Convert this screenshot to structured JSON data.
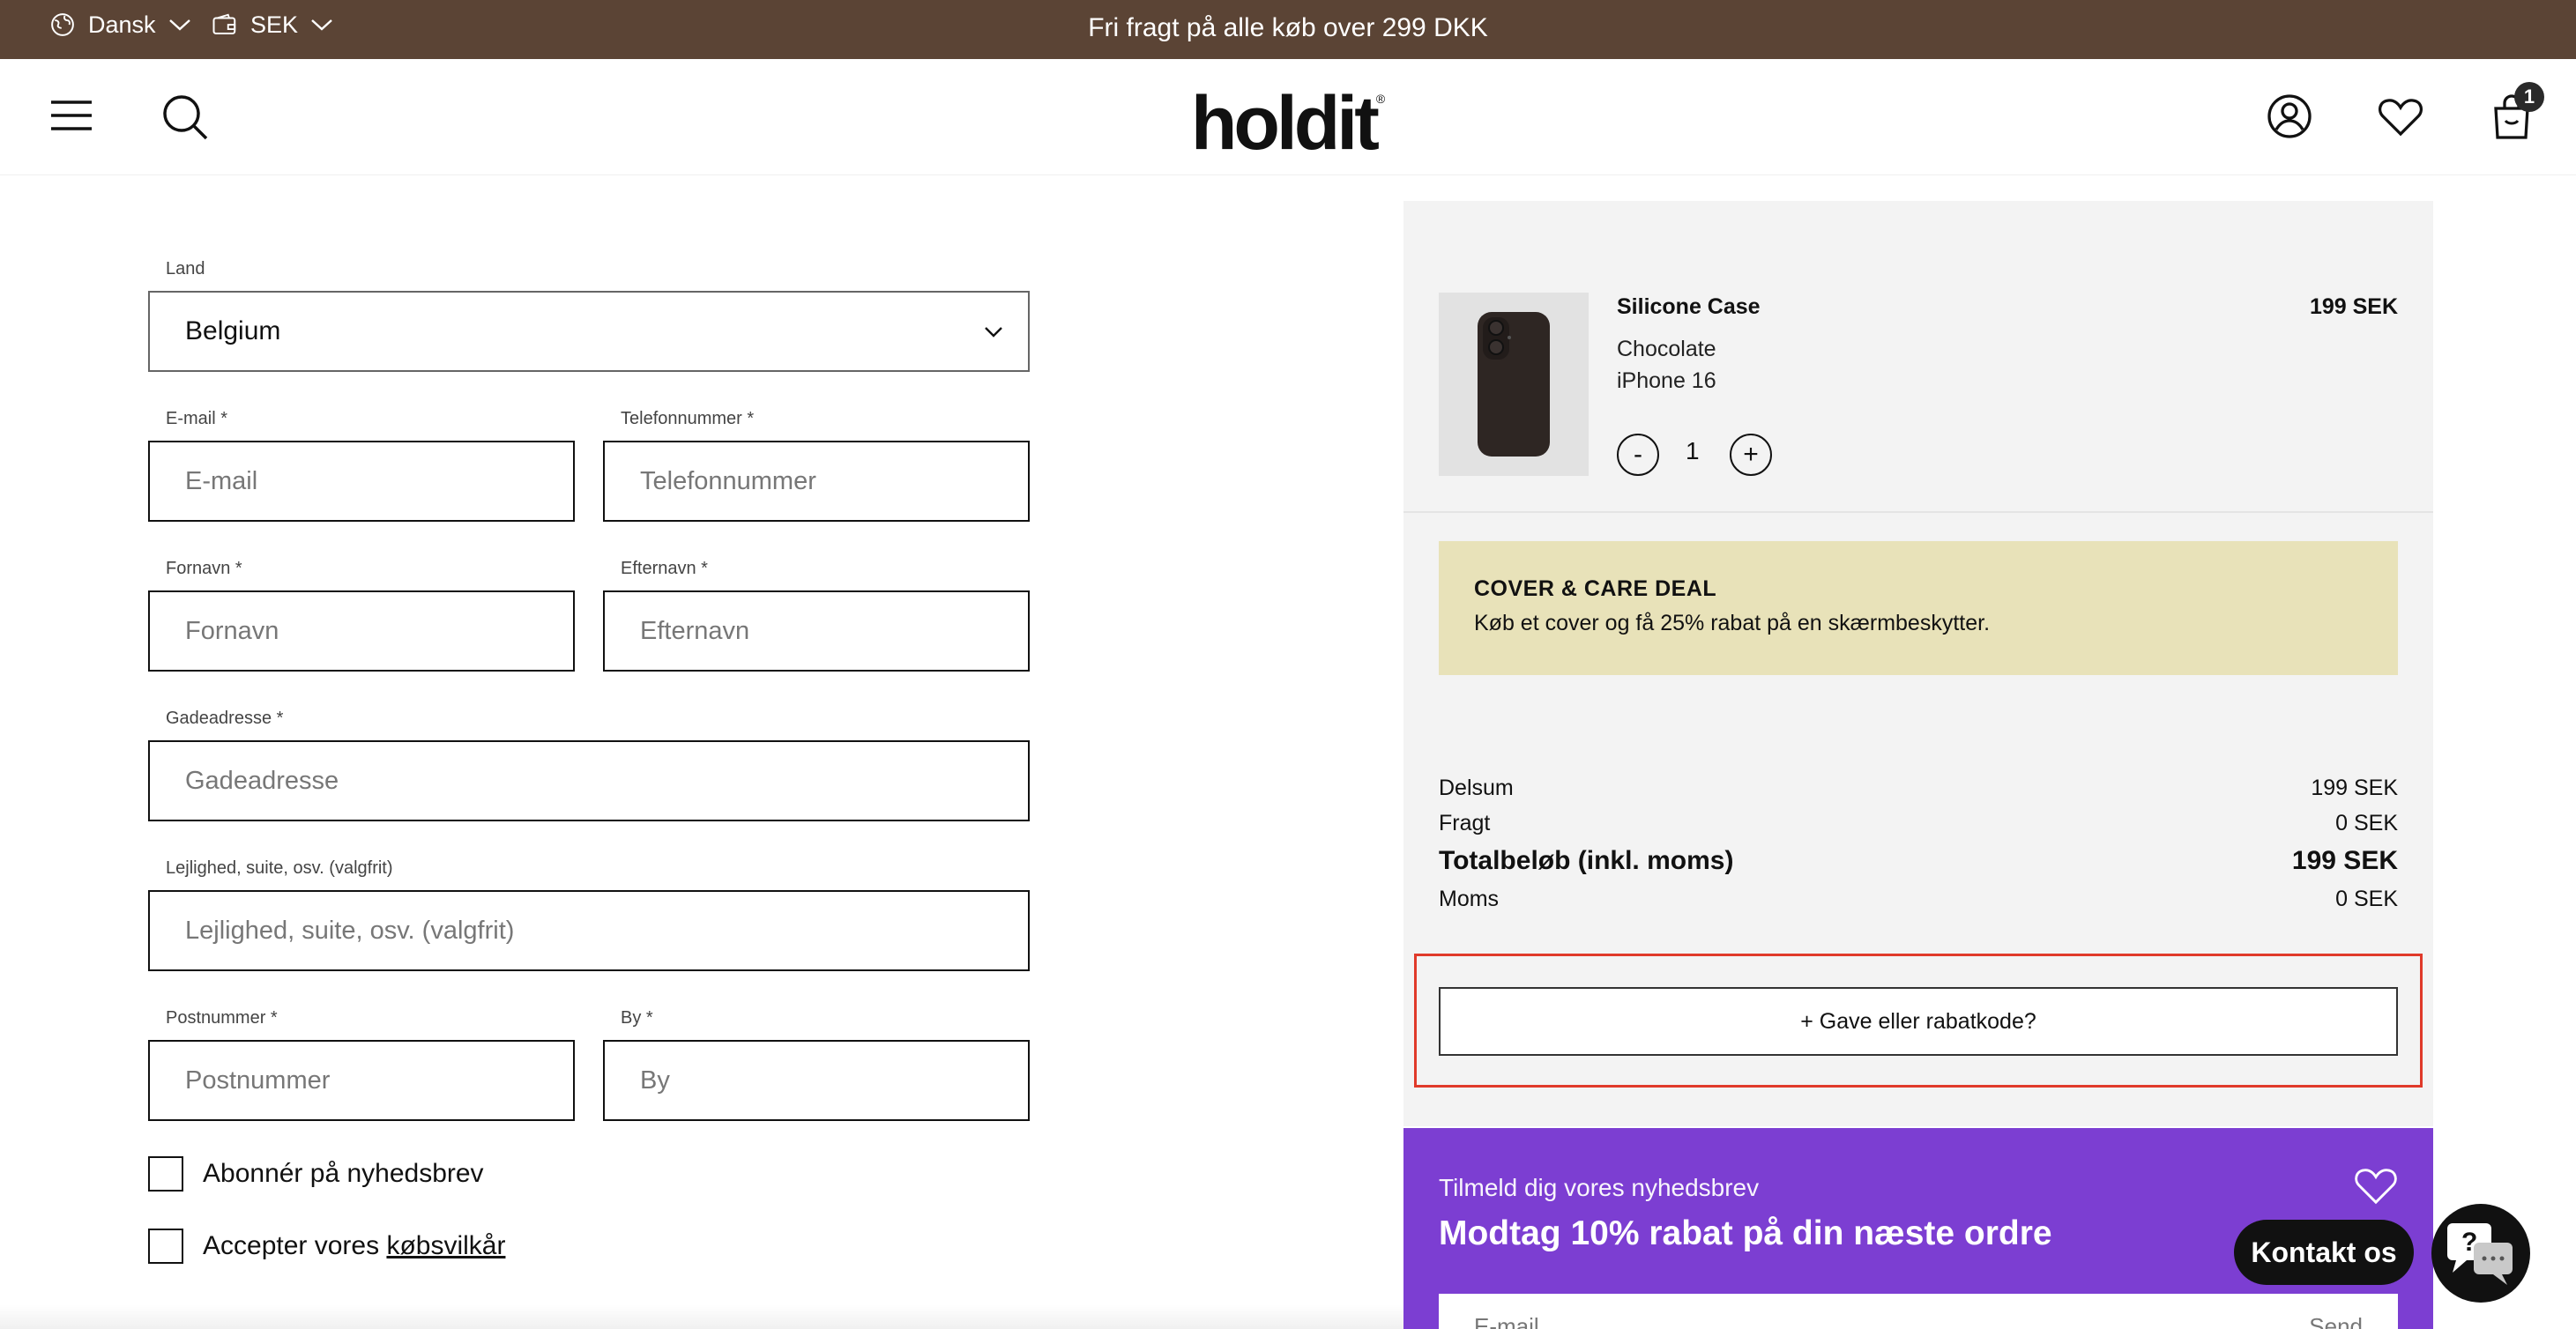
{
  "topbar": {
    "language": "Dansk",
    "currency": "SEK",
    "announcement": "Fri fragt på alle køb over 299 DKK"
  },
  "header": {
    "logo": "holdit",
    "cart_count": "1"
  },
  "form": {
    "country": {
      "label": "Land",
      "value": "Belgium"
    },
    "email": {
      "label": "E-mail *",
      "placeholder": "E-mail"
    },
    "phone": {
      "label": "Telefonnummer *",
      "placeholder": "Telefonnummer"
    },
    "first_name": {
      "label": "Fornavn *",
      "placeholder": "Fornavn"
    },
    "last_name": {
      "label": "Efternavn *",
      "placeholder": "Efternavn"
    },
    "street": {
      "label": "Gadeadresse *",
      "placeholder": "Gadeadresse"
    },
    "apartment": {
      "label": "Lejlighed, suite, osv. (valgfrit)",
      "placeholder": "Lejlighed, suite, osv. (valgfrit)"
    },
    "postcode": {
      "label": "Postnummer *",
      "placeholder": "Postnummer"
    },
    "city": {
      "label": "By *",
      "placeholder": "By"
    },
    "newsletter_checkbox": "Abonnér på nyhedsbrev",
    "terms_prefix": "Accepter vores",
    "terms_link": "købsvilkår"
  },
  "cart": {
    "item": {
      "name": "Silicone Case",
      "price": "199 SEK",
      "color": "Chocolate",
      "model": "iPhone 16",
      "quantity": "1",
      "minus": "-",
      "plus": "+"
    },
    "deal": {
      "title": "COVER & CARE DEAL",
      "text": "Køb et cover og få 25% rabat på en skærmbeskytter."
    },
    "summary": {
      "subtotal_label": "Delsum",
      "subtotal": "199 SEK",
      "shipping_label": "Fragt",
      "shipping": "0 SEK",
      "total_label": "Totalbeløb (inkl. moms)",
      "total": "199 SEK",
      "vat_label": "Moms",
      "vat": "0 SEK"
    },
    "gift_button": "+ Gave eller rabatkode?"
  },
  "newsletter": {
    "kicker": "Tilmeld dig vores nyhedsbrev",
    "headline": "Modtag 10% rabat på din næste ordre",
    "placeholder": "E-mail",
    "submit": "Send"
  },
  "contact": {
    "label": "Kontakt os",
    "chat_glyph": "?"
  },
  "colors": {
    "topbar": "#5b4435",
    "deal_bg": "#e8e2b9",
    "newsletter_bg": "#7c3ed2",
    "highlight": "#e03a2a"
  }
}
